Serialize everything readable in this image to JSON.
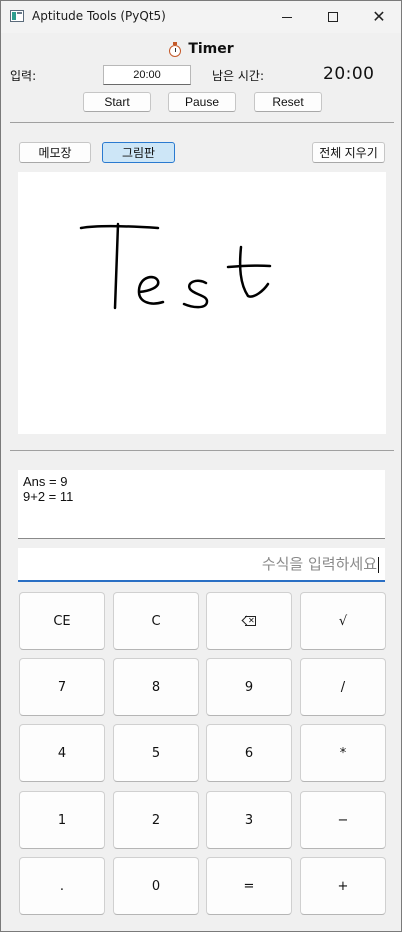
{
  "window": {
    "title": "Aptitude Tools (PyQt5)",
    "minimize_glyph": "",
    "close_glyph": "✕"
  },
  "timer": {
    "title": "Timer",
    "icon": "stopwatch-icon",
    "input_label": "입력:",
    "input_value": "20:00",
    "remaining_label": "남은 시간:",
    "remaining_value": "20:00",
    "start_label": "Start",
    "pause_label": "Pause",
    "reset_label": "Reset"
  },
  "notes": {
    "memo_tab_label": "메모장",
    "draw_tab_label": "그림판",
    "active_tab": "그림판",
    "clear_all_label": "전체 지우기",
    "canvas_text": "Test",
    "active_color": "#2a7ad0"
  },
  "calculator": {
    "history": [
      "Ans = 9",
      "9+2 = 11"
    ],
    "expression_value": "",
    "expression_placeholder": "수식을 입력하세요",
    "accent_color": "#2a6fc4",
    "keys": [
      {
        "label": "CE",
        "name": "key-ce"
      },
      {
        "label": "C",
        "name": "key-c"
      },
      {
        "label": "",
        "name": "key-backspace",
        "icon": "backspace-icon"
      },
      {
        "label": "√",
        "name": "key-sqrt"
      },
      {
        "label": "7",
        "name": "key-7"
      },
      {
        "label": "8",
        "name": "key-8"
      },
      {
        "label": "9",
        "name": "key-9"
      },
      {
        "label": "/",
        "name": "key-divide"
      },
      {
        "label": "4",
        "name": "key-4"
      },
      {
        "label": "5",
        "name": "key-5"
      },
      {
        "label": "6",
        "name": "key-6"
      },
      {
        "label": "*",
        "name": "key-multiply"
      },
      {
        "label": "1",
        "name": "key-1"
      },
      {
        "label": "2",
        "name": "key-2"
      },
      {
        "label": "3",
        "name": "key-3"
      },
      {
        "label": "−",
        "name": "key-subtract"
      },
      {
        "label": ".",
        "name": "key-decimal"
      },
      {
        "label": "0",
        "name": "key-0"
      },
      {
        "label": "=",
        "name": "key-equals"
      },
      {
        "label": "+",
        "name": "key-add"
      }
    ]
  }
}
